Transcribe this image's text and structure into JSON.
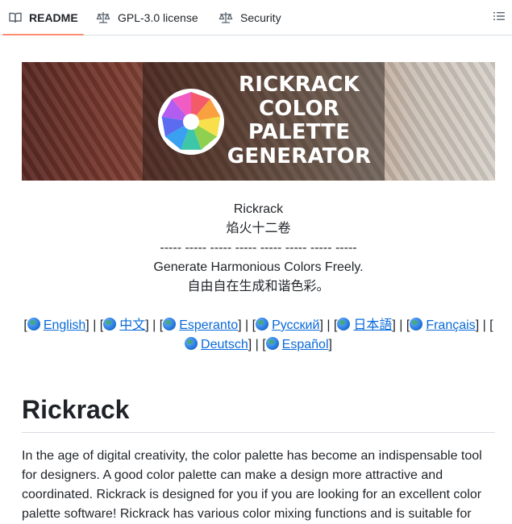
{
  "tabs": {
    "readme": "README",
    "license": "GPL-3.0 license",
    "security": "Security",
    "accent_color": "#fd8c73"
  },
  "banner": {
    "title_lines": [
      "RICKRACK",
      "COLOR",
      "PALETTE",
      "GENERATOR"
    ],
    "logo_colors": [
      "#f45b69",
      "#f9a03f",
      "#f7e04b",
      "#8fd14f",
      "#3ec6a8",
      "#3aa0f0",
      "#5b6cf0",
      "#b25cf0",
      "#f05cc4"
    ]
  },
  "intro": {
    "line1": "Rickrack",
    "line2": "焰火十二卷",
    "line3": "----- ----- ----- ----- ----- ----- ----- -----",
    "line4": "Generate Harmonious Colors Freely.",
    "line5": "自由自在生成和谐色彩。"
  },
  "languages": [
    {
      "label": "English"
    },
    {
      "label": "中文"
    },
    {
      "label": "Esperanto"
    },
    {
      "label": "Русский"
    },
    {
      "label": "日本語"
    },
    {
      "label": "Français"
    },
    {
      "label": "Deutsch"
    },
    {
      "label": "Español"
    }
  ],
  "link_color": "#0969da",
  "heading": "Rickrack",
  "paragraph": "In the age of digital creativity, the color palette has become an indispensable tool for designers. A good color palette can make a design more attractive and coordinated. Rickrack is designed for you if you are looking for an excellent color palette software! Rickrack has various color mixing functions and is suitable for"
}
